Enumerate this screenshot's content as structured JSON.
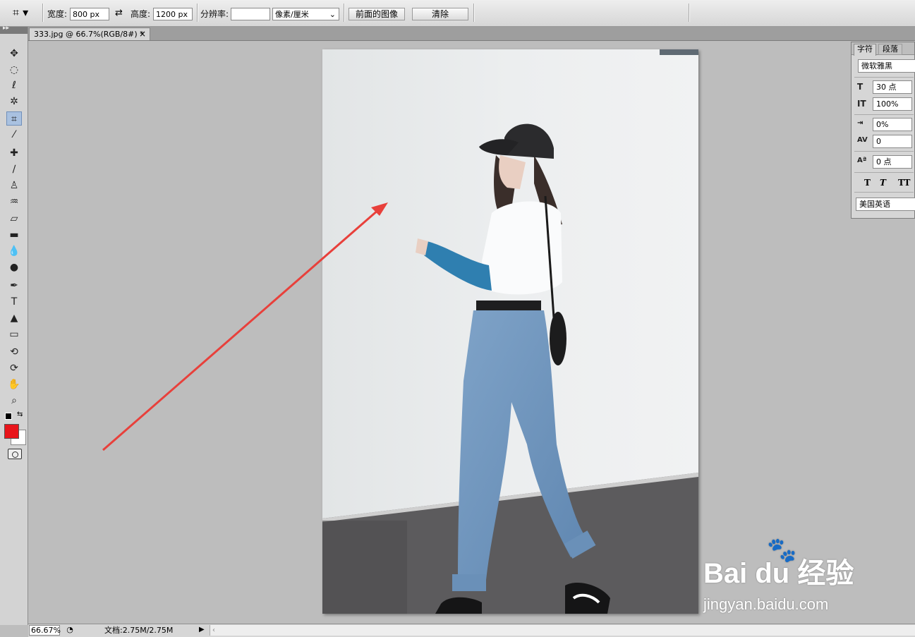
{
  "options_bar": {
    "width_label": "宽度:",
    "width_value": "800 px",
    "height_label": "高度:",
    "height_value": "1200 px",
    "resolution_label": "分辨率:",
    "resolution_value": "",
    "unit_select": "像素/厘米",
    "front_image_button": "前面的图像",
    "clear_button": "清除"
  },
  "document": {
    "tab_title": "333.jpg @ 66.7%(RGB/8#) *",
    "close_glyph": "×"
  },
  "toolbox": {
    "tools": [
      {
        "icon": "move-icon",
        "glyph": "✥"
      },
      {
        "icon": "marquee-icon",
        "glyph": "◌"
      },
      {
        "icon": "lasso-icon",
        "glyph": "ℓ"
      },
      {
        "icon": "magic-wand-icon",
        "glyph": "✲"
      },
      {
        "icon": "crop-icon",
        "glyph": "⌗"
      },
      {
        "icon": "eyedropper-icon",
        "glyph": "⁄"
      },
      {
        "icon": "healing-brush-icon",
        "glyph": "✚"
      },
      {
        "icon": "brush-icon",
        "glyph": "∕"
      },
      {
        "icon": "clone-stamp-icon",
        "glyph": "♙"
      },
      {
        "icon": "history-brush-icon",
        "glyph": "♒"
      },
      {
        "icon": "eraser-icon",
        "glyph": "▱"
      },
      {
        "icon": "gradient-icon",
        "glyph": "▬"
      },
      {
        "icon": "blur-icon",
        "glyph": "💧"
      },
      {
        "icon": "dodge-icon",
        "glyph": "●"
      },
      {
        "icon": "pen-icon",
        "glyph": "✒"
      },
      {
        "icon": "type-icon",
        "glyph": "T"
      },
      {
        "icon": "path-selection-icon",
        "glyph": "▲"
      },
      {
        "icon": "rectangle-shape-icon",
        "glyph": "▭"
      },
      {
        "icon": "3d-rotate-icon",
        "glyph": "⟲"
      },
      {
        "icon": "3d-orbit-icon",
        "glyph": "⟳"
      },
      {
        "icon": "hand-icon",
        "glyph": "✋"
      },
      {
        "icon": "zoom-icon",
        "glyph": "⌕"
      }
    ],
    "foreground_color": "#e8141a",
    "background_color": "#ffffff"
  },
  "character_panel": {
    "tab_character": "字符",
    "tab_paragraph": "段落",
    "font_family": "微软雅黑",
    "font_size": "30 点",
    "vertical_scale": "100%",
    "tracking_percent": "0%",
    "kerning": "0",
    "baseline_shift": "0 点",
    "style_buttons": [
      "T",
      "T",
      "TT"
    ],
    "language": "美国英语"
  },
  "status_bar": {
    "zoom": "66.67%",
    "doc_info": "文档:2.75M/2.75M"
  },
  "watermark": {
    "logo_text": "Bai du 经验",
    "url": "jingyan.baidu.com"
  },
  "colors": {
    "arrow": "#e8403b",
    "workspace": "#bdbdbd"
  }
}
